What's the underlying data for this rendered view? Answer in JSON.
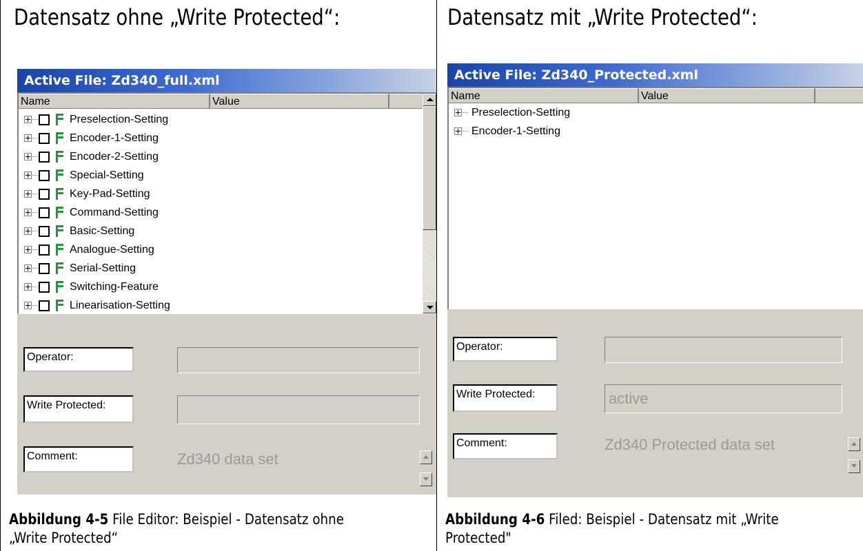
{
  "left": {
    "heading": "Datensatz ohne „Write Protected“:",
    "title": "Active File: Zd340_full.xml",
    "columns": [
      "Name",
      "Value"
    ],
    "rows": [
      "Preselection-Setting",
      "Encoder-1-Setting",
      "Encoder-2-Setting",
      "Special-Setting",
      "Key-Pad-Setting",
      "Command-Setting",
      "Basic-Setting",
      "Analogue-Setting",
      "Serial-Setting",
      "Switching-Feature",
      "Linearisation-Setting"
    ],
    "operator_label": "Operator:",
    "operator_value": "",
    "write_protected_label": "Write Protected:",
    "write_protected_value": "",
    "comment_label": "Comment:",
    "comment_value": "Zd340 data set",
    "caption_bold": "Abbildung 4-5",
    "caption_text": " File Editor: Beispiel - Datensatz ohne „Write Protected“"
  },
  "right": {
    "heading": "Datensatz mit „Write Protected“:",
    "title": "Active File: Zd340_Protected.xml",
    "columns": [
      "Name",
      "Value"
    ],
    "rows": [
      "Preselection-Setting",
      "Encoder-1-Setting"
    ],
    "operator_label": "Operator:",
    "operator_value": "",
    "write_protected_label": "Write Protected:",
    "write_protected_value": "active",
    "comment_label": "Comment:",
    "comment_value": "Zd340 Protected data set",
    "caption_bold": "Abbildung 4-6",
    "caption_text": " Filed: Beispiel - Datensatz mit „Write Protected\""
  },
  "colors": {
    "title_gradient_start": "#1a44a8",
    "panel_bg": "#d4d0c8",
    "f_icon": "#1d9a3a"
  },
  "icons": [
    "plus-expander-icon",
    "checkbox-icon",
    "f-file-icon",
    "scroll-up-arrow-icon",
    "scroll-down-arrow-icon"
  ]
}
